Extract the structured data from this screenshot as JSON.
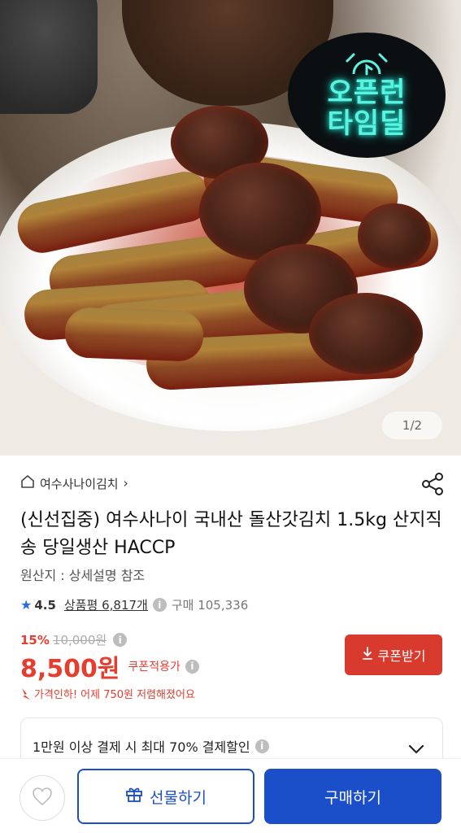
{
  "image": {
    "badge_line1": "오픈런",
    "badge_line2": "타임딜",
    "pager": "1/2"
  },
  "store": {
    "name": "여수사나이김치",
    "chevron": "›"
  },
  "product": {
    "title": "(신선집중) 여수사나이 국내산 돌산갓김치 1.5kg 산지직송 당일생산 HACCP",
    "origin": "원산지 : 상세설명 참조"
  },
  "rating": {
    "score": "4.5",
    "review_label": "상품평 6,817개",
    "purchase_label": "구매 105,336"
  },
  "price": {
    "discount_pct": "15%",
    "original": "10,000원",
    "final": "8,500원",
    "coupon_applied": "쿠폰적용가",
    "price_drop": "가격인하! 어제 750원 저렴해졌어요"
  },
  "coupon_button": {
    "label": "쿠폰받기"
  },
  "promo": {
    "text": "1만원 이상 결제 시 최대  70% 결제할인"
  },
  "bottom_bar": {
    "gift_label": "선물하기",
    "buy_label": "구매하기"
  },
  "colors": {
    "accent_red": "#e53d2f",
    "brand_blue": "#1a4fc9",
    "neon_cyan": "#5cf2e0"
  },
  "icons": [
    "home-icon",
    "share-icon",
    "star-icon",
    "info-icon",
    "download-icon",
    "price-drop-arrow-icon",
    "chevron-down-icon",
    "heart-icon",
    "gift-icon",
    "alarm-clock-icon"
  ]
}
